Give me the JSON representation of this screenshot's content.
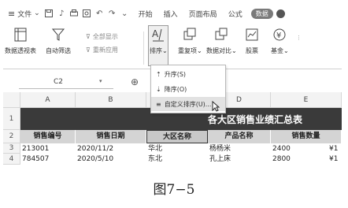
{
  "menubar": {
    "file": "文件",
    "tabs": [
      "开始",
      "插入",
      "页面布局",
      "公式",
      "数据"
    ],
    "active_tab": "数据"
  },
  "ribbon": {
    "pivot_table": "数据透视表",
    "auto_filter": "自动筛选",
    "show_all": "全部显示",
    "reapply": "重新应用",
    "sort": "排序",
    "duplicates": "重复项",
    "compare": "数据对比",
    "stocks": "股票",
    "fund": "基金"
  },
  "formula_bar": {
    "cell_ref": "C2"
  },
  "columns": [
    "A",
    "B",
    "C",
    "D",
    "E"
  ],
  "rows": [
    "1",
    "2",
    "3",
    "4"
  ],
  "sheet": {
    "title": "各大区销售业绩汇总表",
    "headers": [
      "销售编号",
      "销售日期",
      "大区名称",
      "产品名称",
      "销售数量"
    ],
    "rows": [
      [
        "213001",
        "2020/11/2",
        "华北",
        "杨杨米",
        "2400",
        "¥1"
      ],
      [
        "784507",
        "2020/5/10",
        "东北",
        "孔上床",
        "2800",
        "¥1"
      ]
    ]
  },
  "sort_menu": {
    "items": [
      "升序(S)",
      "降序(O)",
      "自定义排序(U)..."
    ],
    "highlighted": 2
  },
  "caption": "图7−5"
}
